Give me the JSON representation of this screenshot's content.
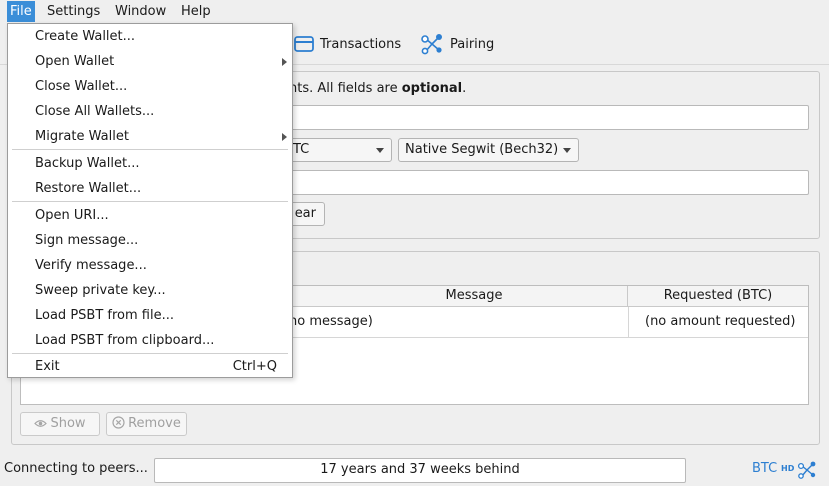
{
  "menubar": {
    "file": "File",
    "settings": "Settings",
    "window": "Window",
    "help": "Help"
  },
  "toolbar": {
    "transactions": "Transactions",
    "pairing": "Pairing"
  },
  "form": {
    "instruction_prefix": "nts. All fields are ",
    "instruction_bold": "optional",
    "instruction_suffix": ".",
    "unit": "TC",
    "address_type": "Native Segwit (Bech32)",
    "clear_label": "ear"
  },
  "history": {
    "columns": [
      "Message",
      "Requested (BTC)"
    ],
    "rows": [
      {
        "message": "no message)",
        "requested": "(no amount requested)"
      }
    ],
    "show_label": "Show",
    "remove_label": "Remove"
  },
  "status": {
    "connecting": "Connecting to peers...",
    "sync": "17 years and 37 weeks behind",
    "unit": "BTC",
    "hd": "HD"
  },
  "file_menu": {
    "create_wallet": "Create Wallet...",
    "open_wallet": "Open Wallet",
    "close_wallet": "Close Wallet...",
    "close_all_wallets": "Close All Wallets...",
    "migrate_wallet": "Migrate Wallet",
    "backup_wallet": "Backup Wallet...",
    "restore_wallet": "Restore Wallet...",
    "open_uri": "Open URI...",
    "sign_message": "Sign message...",
    "verify_message": "Verify message...",
    "sweep_private_key": "Sweep private key...",
    "load_psbt_file": "Load PSBT from file...",
    "load_psbt_clipboard": "Load PSBT from clipboard...",
    "exit": "Exit",
    "exit_shortcut": "Ctrl+Q"
  },
  "colors": {
    "accent": "#3b8ed8",
    "icon_blue": "#2d7fd1"
  }
}
